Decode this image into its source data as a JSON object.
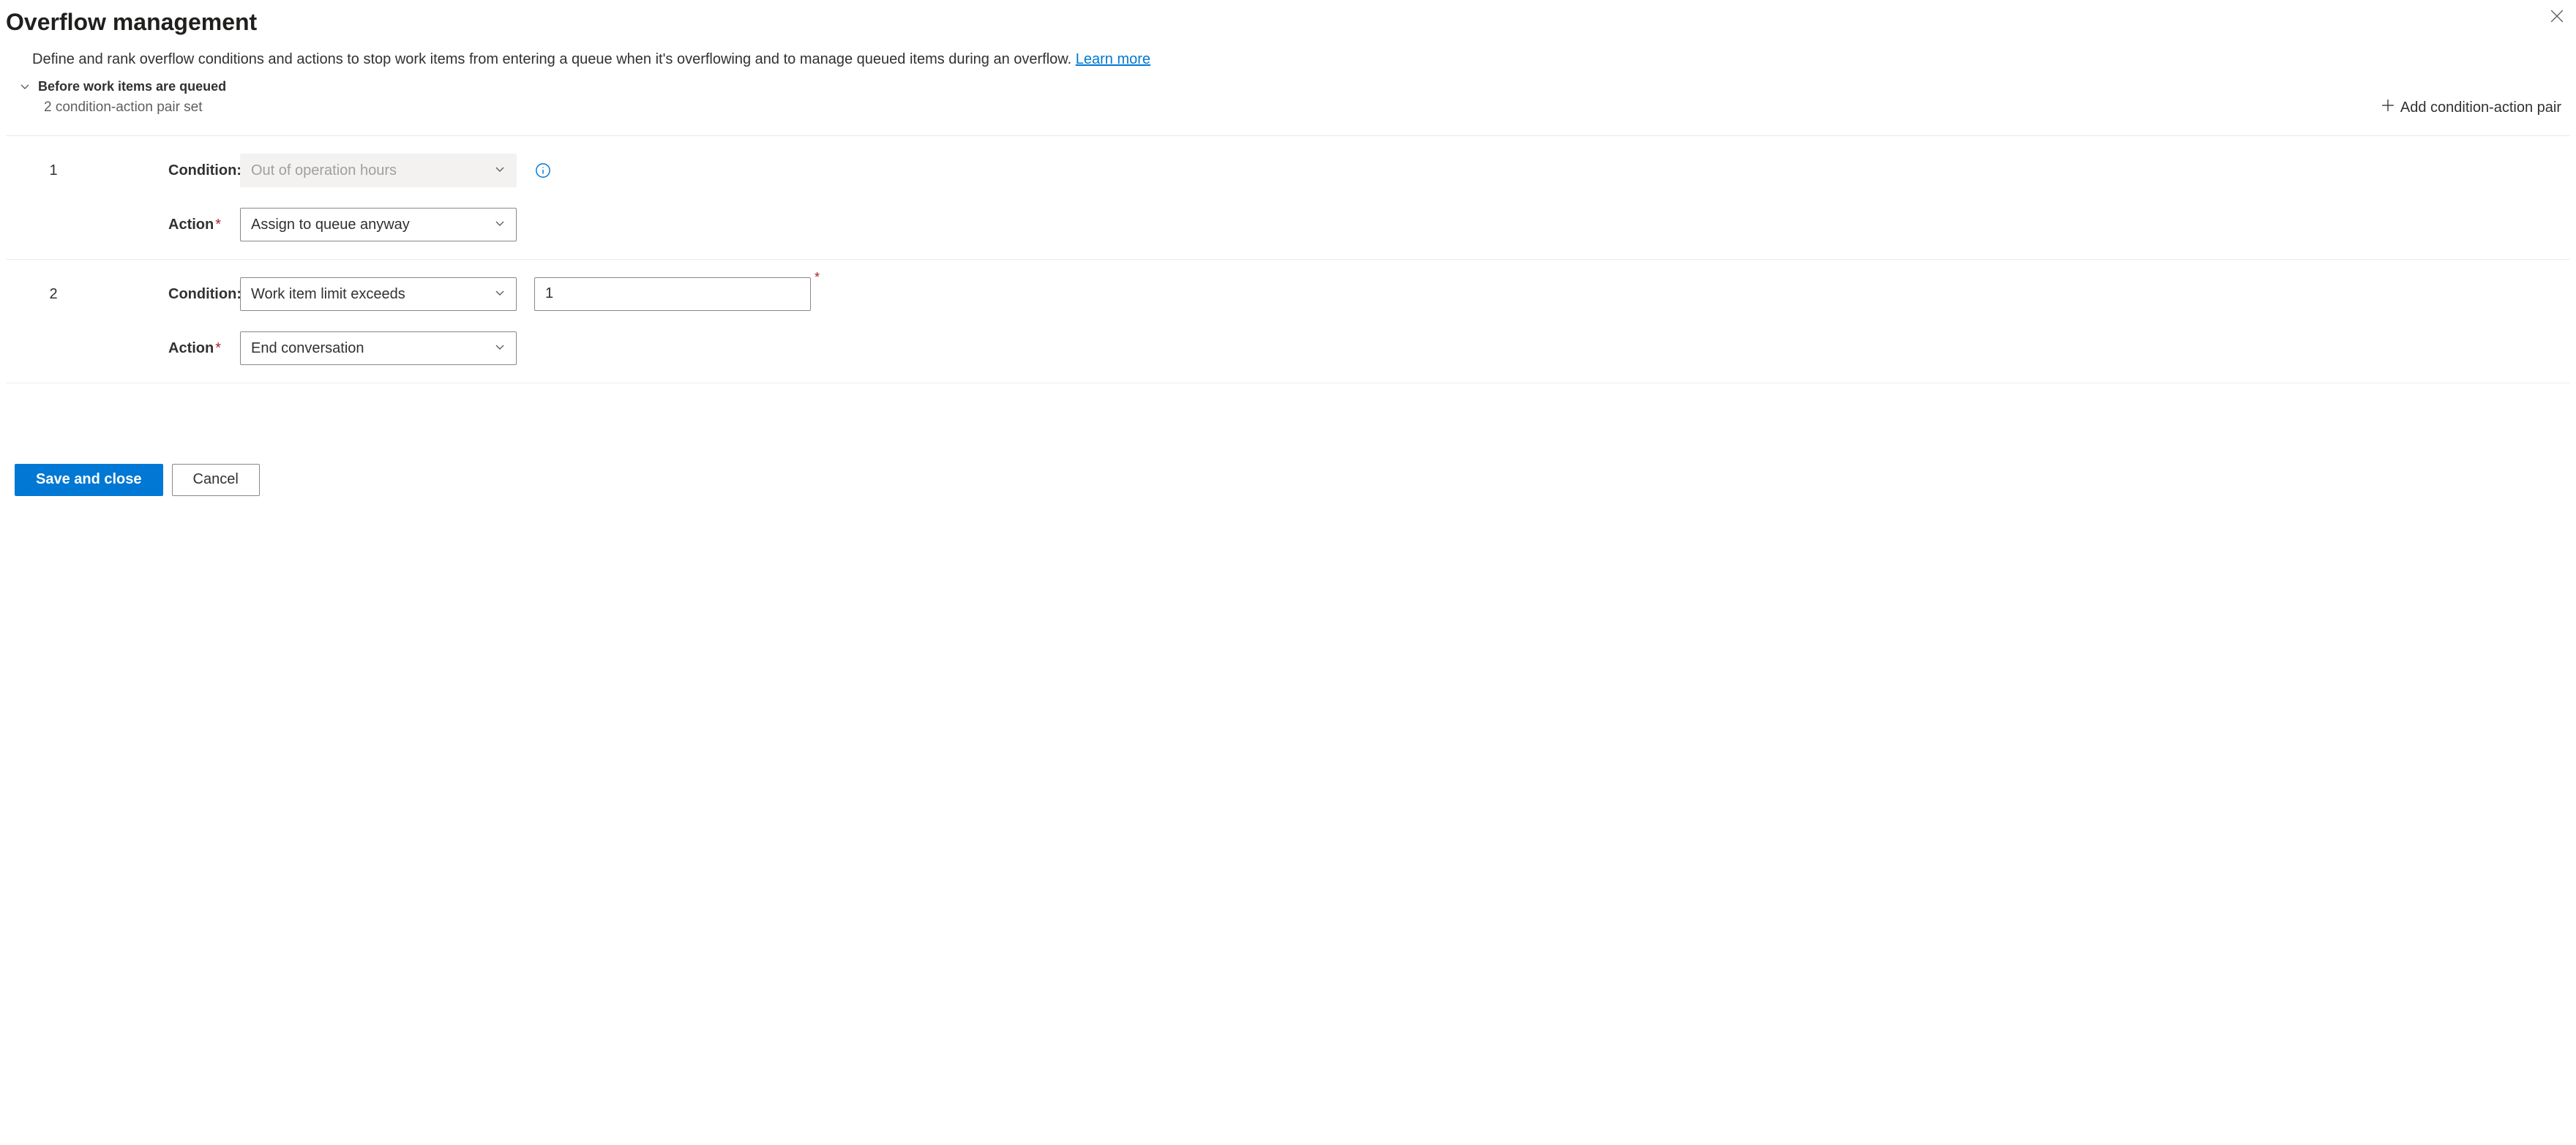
{
  "header": {
    "title": "Overflow management",
    "description_prefix": "Define and rank overflow conditions and actions to stop work items from entering a queue when it's overflowing and to manage queued items during an overflow. ",
    "learn_more": "Learn more"
  },
  "section": {
    "title": "Before work items are queued",
    "subtitle": "2 condition-action pair set",
    "add_label": "Add condition-action pair"
  },
  "labels": {
    "condition": "Condition:",
    "action": "Action"
  },
  "pairs": [
    {
      "index": "1",
      "condition_value": "Out of operation hours",
      "condition_disabled": true,
      "has_info": true,
      "action_value": "Assign to queue anyway",
      "extra_input": null
    },
    {
      "index": "2",
      "condition_value": "Work item limit exceeds",
      "condition_disabled": false,
      "has_info": false,
      "action_value": "End conversation",
      "extra_input": "1"
    }
  ],
  "footer": {
    "save": "Save and close",
    "cancel": "Cancel"
  }
}
